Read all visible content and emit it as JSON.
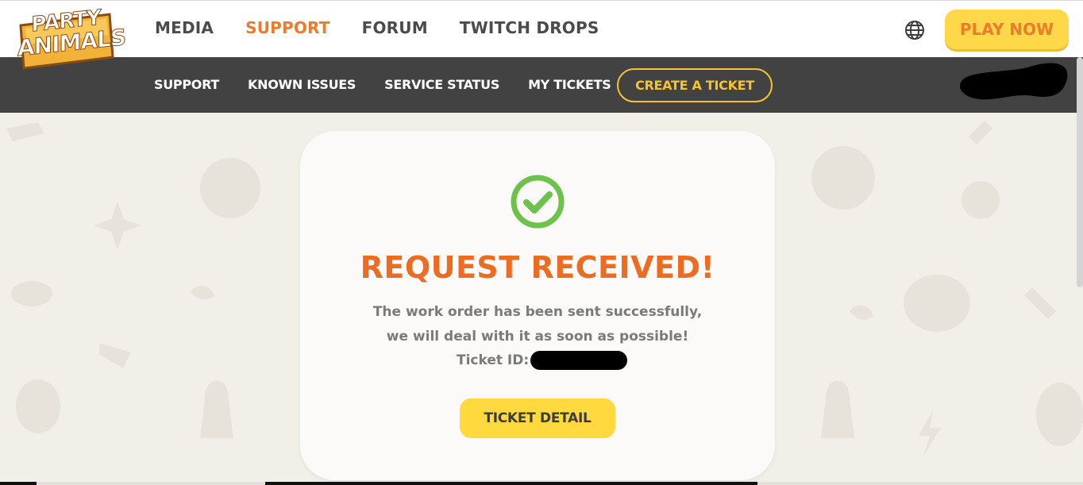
{
  "brand": {
    "logo_line1": "PARTY",
    "logo_line2": "ANIMALS"
  },
  "main_nav": {
    "items": [
      "MEDIA",
      "SUPPORT",
      "FORUM",
      "TWITCH DROPS"
    ],
    "active": "SUPPORT",
    "play_label": "PLAY NOW",
    "language_icon": "globe-icon"
  },
  "sub_nav": {
    "items": [
      "SUPPORT",
      "KNOWN ISSUES",
      "SERVICE STATUS",
      "MY TICKETS"
    ],
    "create_label": "CREATE A TICKET"
  },
  "confirmation": {
    "icon": "check-circle-icon",
    "title": "REQUEST RECEIVED!",
    "line1": "The work order has been sent successfully,",
    "line2": "we will deal with it as soon as possible!",
    "ticket_label": "Ticket ID:",
    "button_label": "TICKET DETAIL"
  },
  "colors": {
    "accent_orange": "#ec6d21",
    "accent_yellow": "#ffd93d",
    "subnav_bg": "#424242",
    "page_bg": "#f2efe8",
    "success_green": "#6cc24a"
  }
}
